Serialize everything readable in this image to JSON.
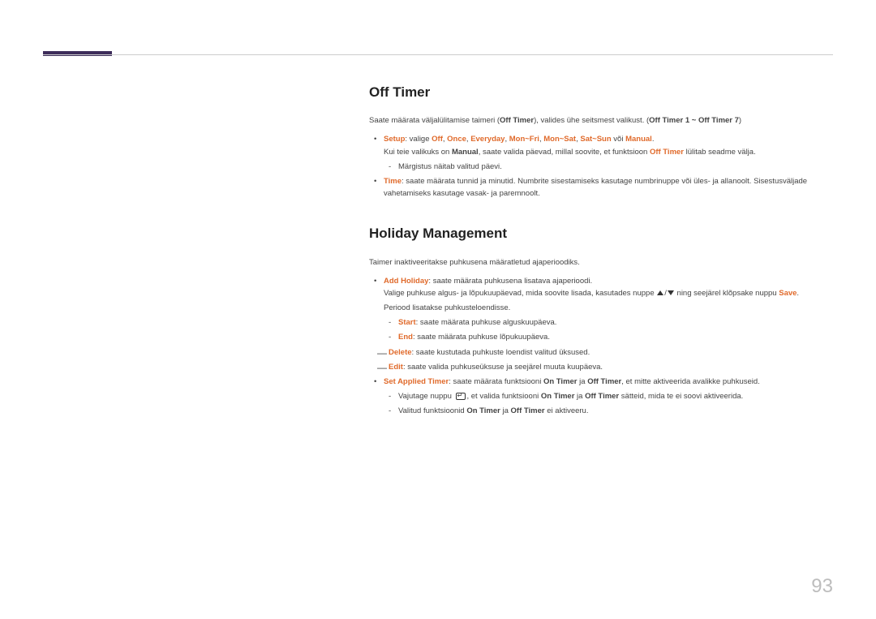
{
  "page_number": "93",
  "section1": {
    "heading": "Off Timer",
    "intro_pre": "Saate määrata väljalülitamise taimeri (",
    "intro_bold": "Off Timer",
    "intro_mid": "), valides ühe seitsmest valikust. (",
    "intro_range": "Off Timer 1 ~ Off Timer 7",
    "intro_post": ")",
    "setup_label": "Setup",
    "setup_valige": ": valige ",
    "opt_off": "Off",
    "opt_once": "Once",
    "opt_everyday": "Everyday",
    "opt_monfri": "Mon~Fri",
    "opt_monsat": "Mon~Sat",
    "opt_satsun": "Sat~Sun",
    "opt_voi": " või ",
    "opt_manual": "Manual",
    "setup_dot": ".",
    "setup_line2_pre": "Kui teie valikuks on ",
    "setup_line2_manual": "Manual",
    "setup_line2_mid": ", saate valida päevad, millal soovite, et funktsioon ",
    "setup_line2_offtimer": "Off Timer",
    "setup_line2_post": " lülitab seadme välja.",
    "setup_sub": "Märgistus näitab valitud päevi.",
    "time_label": "Time",
    "time_text": ": saate määrata tunnid ja minutid. Numbrite sisestamiseks kasutage numbrinuppe või üles- ja allanoolt. Sisestusväljade vahetamiseks kasutage vasak- ja paremnoolt."
  },
  "section2": {
    "heading": "Holiday Management",
    "intro": "Taimer inaktiveeritakse puhkusena määratletud ajaperioodiks.",
    "add_label": "Add Holiday",
    "add_text": ": saate määrata puhkusena lisatava ajaperioodi.",
    "add_line2_pre": "Valige puhkuse algus- ja lõpukuupäevad, mida soovite lisada, kasutades nuppe ",
    "add_line2_mid": " ning seejärel klõpsake nuppu ",
    "add_line2_save": "Save",
    "add_line2_post": ".",
    "period_text": "Periood lisatakse puhkusteloendisse.",
    "start_label": "Start",
    "start_text": ": saate määrata puhkuse alguskuupäeva.",
    "end_label": "End",
    "end_text": ": saate määrata puhkuse lõpukuupäeva.",
    "delete_label": "Delete",
    "delete_text": ": saate kustutada puhkuste loendist valitud üksused.",
    "edit_label": "Edit",
    "edit_text": ": saate valida puhkuseüksuse ja seejärel muuta kuupäeva.",
    "sat_label": "Set Applied Timer",
    "sat_pre": ": saate määrata funktsiooni ",
    "on_timer": "On Timer",
    "sat_ja": " ja ",
    "off_timer": "Off Timer",
    "sat_post": ", et mitte aktiveerida avalikke puhkuseid.",
    "sat_sub1_pre": "Vajutage nuppu ",
    "sat_sub1_mid": ", et valida funktsiooni ",
    "sat_sub1_post": " sätteid, mida te ei soovi aktiveerida.",
    "sat_sub2_pre": "Valitud funktsioonid ",
    "sat_sub2_post": " ei aktiveeru."
  }
}
